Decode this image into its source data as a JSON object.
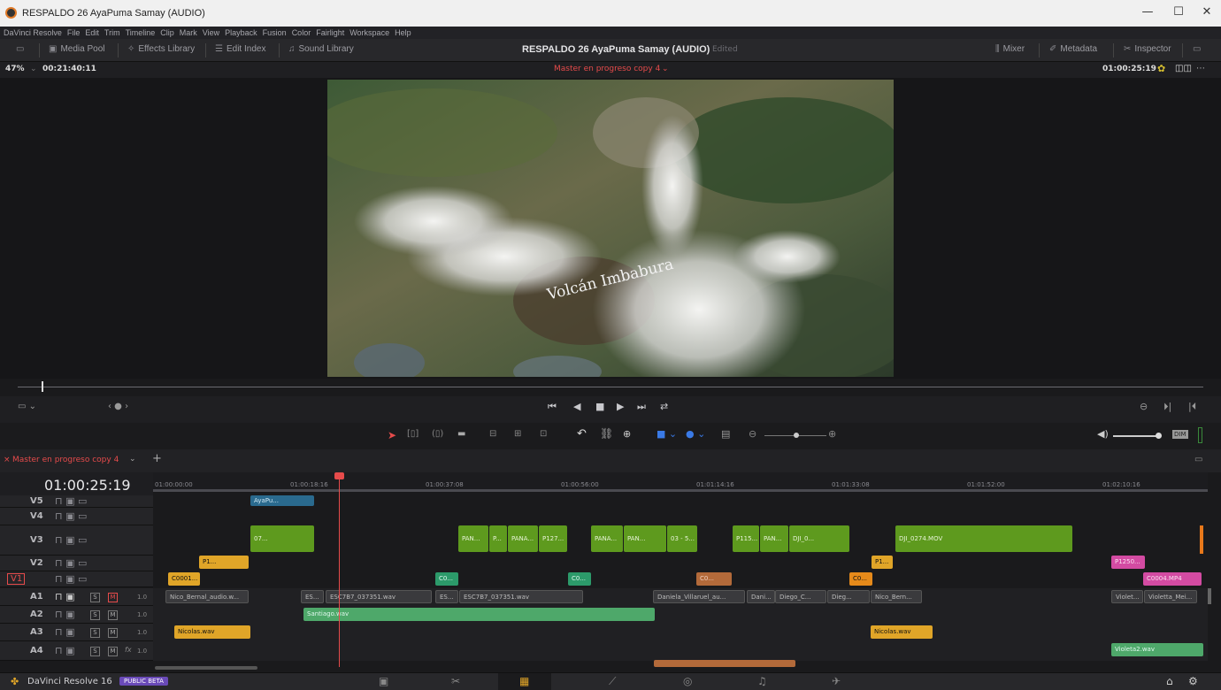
{
  "window": {
    "title": "RESPALDO 26 AyaPuma Samay (AUDIO)",
    "minimize": "—",
    "maximize": "☐",
    "close": "✕"
  },
  "menu": [
    "DaVinci Resolve",
    "File",
    "Edit",
    "Trim",
    "Timeline",
    "Clip",
    "Mark",
    "View",
    "Playback",
    "Fusion",
    "Color",
    "Fairlight",
    "Workspace",
    "Help"
  ],
  "toolbar": {
    "media_pool": "Media Pool",
    "effects_library": "Effects Library",
    "edit_index": "Edit Index",
    "sound_library": "Sound Library",
    "project_title": "RESPALDO 26 AyaPuma Samay (AUDIO)",
    "edited": "Edited",
    "mixer": "Mixer",
    "metadata": "Metadata",
    "inspector": "Inspector"
  },
  "viewer": {
    "zoom": "47%",
    "source_timecode": "00:21:40:11",
    "timeline_name": "Master en progreso copy 4",
    "record_timecode": "01:00:25:19",
    "overlay_text": "Volcán Imbabura"
  },
  "timeline": {
    "tab_name": "Master en progreso copy 4",
    "current_timecode": "01:00:25:19",
    "ruler": [
      "01:00:00:00",
      "01:00:18:16",
      "01:00:37:08",
      "01:00:56:00",
      "01:01:14:16",
      "01:01:33:08",
      "01:01:52:00",
      "01:02:10:16"
    ],
    "tracks": [
      {
        "name": "V5",
        "type": "video"
      },
      {
        "name": "V4",
        "type": "video"
      },
      {
        "name": "V3",
        "type": "video"
      },
      {
        "name": "V2",
        "type": "video"
      },
      {
        "name": "V1",
        "type": "video"
      },
      {
        "name": "A1",
        "type": "audio",
        "level": "1.0"
      },
      {
        "name": "A2",
        "type": "audio",
        "level": "1.0"
      },
      {
        "name": "A3",
        "type": "audio",
        "level": "1.0"
      },
      {
        "name": "A4",
        "type": "audio",
        "level": "1.0"
      }
    ],
    "clips": {
      "v5": [
        "AyaPu..."
      ],
      "v3": [
        "07...",
        "PAN...",
        "P...",
        "PANA...",
        "P127...",
        "PANA...",
        "PAN...",
        "03 - 5...",
        "P115...",
        "PAN...",
        "DJI_0...",
        "DJI_0274.MOV"
      ],
      "v2": [
        "P1...",
        "P1...",
        "P1250..."
      ],
      "v1": [
        "C0001...",
        "C0...",
        "C0...",
        "C0...",
        "C0...",
        "C0004.MP4"
      ],
      "a1": [
        "Nico_Bernal_audio.w...",
        "ES...",
        "ESC7B7_037351.wav",
        "ES...",
        "ESC7B7_037351.wav",
        "Daniela_Villaruel_au...",
        "Dani...",
        "Diego_C...",
        "Dieg...",
        "Nico_Bern...",
        "Violet...",
        "Violetta_Mei..."
      ],
      "a2": [
        "Santiago.wav"
      ],
      "a3": [
        "Nicolas.wav",
        "Nicolas.wav"
      ],
      "a4": [
        "Violeta2.wav"
      ]
    }
  },
  "status": {
    "app": "DaVinci Resolve 16",
    "badge": "PUBLIC BETA"
  },
  "colors": {
    "accent_red": "#e64b4b",
    "clip_green": "#5e9a1e",
    "clip_yellow": "#e0a528",
    "clip_pink": "#d34ba2"
  }
}
